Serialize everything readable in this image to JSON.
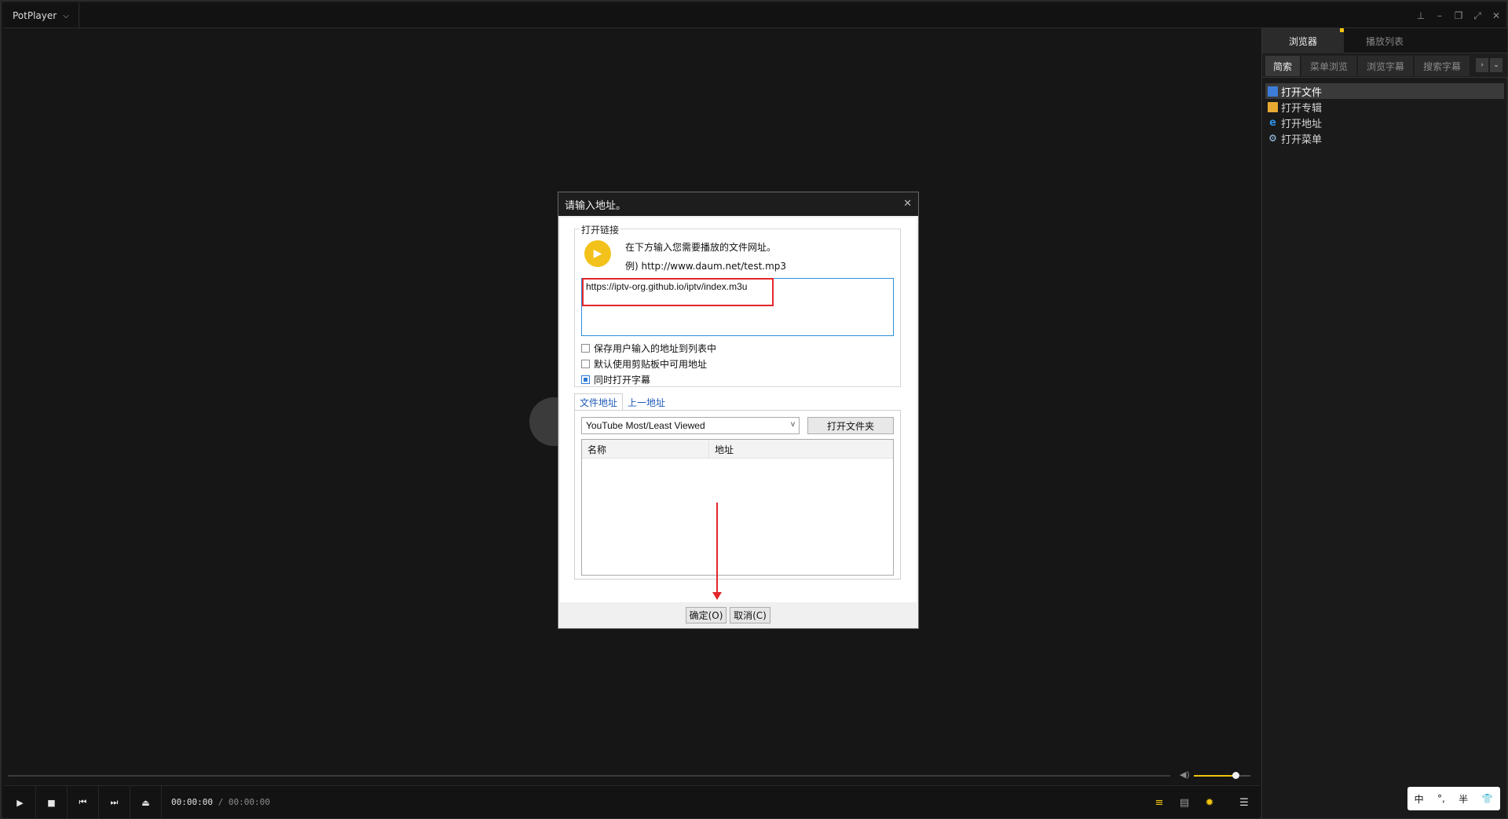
{
  "app": {
    "title": "PotPlayer",
    "window_controls": [
      "pin-icon",
      "minimize-icon",
      "restore-icon",
      "fullscreen-icon",
      "close-icon"
    ]
  },
  "player": {
    "time_current": "00:00:00",
    "time_separator": "/",
    "time_total": "00:00:00",
    "volume_fraction": 0.73,
    "accent_color": "#f1c40f",
    "controls": [
      "play-icon",
      "stop-icon",
      "previous-icon",
      "next-icon",
      "eject-icon"
    ],
    "right_controls": [
      "playlist-search-icon",
      "info-icon",
      "settings-icon",
      "menu-icon"
    ]
  },
  "sidebar": {
    "tabs": [
      {
        "label": "浏览器",
        "active": true
      },
      {
        "label": "播放列表",
        "active": false
      }
    ],
    "sub_tabs": [
      {
        "label": "简索",
        "active": true
      },
      {
        "label": "菜单浏览",
        "active": false
      },
      {
        "label": "浏览字幕",
        "active": false
      },
      {
        "label": "搜索字幕",
        "active": false
      }
    ],
    "items": [
      {
        "label": "打开文件",
        "icon": "folder-icon",
        "selected": true
      },
      {
        "label": "打开专辑",
        "icon": "album-icon",
        "selected": false
      },
      {
        "label": "打开地址",
        "icon": "ie-icon",
        "selected": false
      },
      {
        "label": "打开菜单",
        "icon": "gear-icon",
        "selected": false
      }
    ]
  },
  "ime": {
    "mode": "中",
    "punct": "°,",
    "width": "半",
    "skin_icon": "shirt-icon"
  },
  "dialog": {
    "title": "请输入地址。",
    "group_label": "打开链接",
    "hint_line1": "在下方输入您需要播放的文件网址。",
    "hint_line2": "例) http://www.daum.net/test.mp3",
    "url_value": "https://iptv-org.github.io/iptv/index.m3u",
    "checkboxes": [
      {
        "label": "保存用户输入的地址到列表中",
        "checked": false
      },
      {
        "label": "默认使用剪贴板中可用地址",
        "checked": false
      },
      {
        "label": "同时打开字幕",
        "checked": true
      }
    ],
    "tabs": [
      {
        "label": "文件地址",
        "active": true
      },
      {
        "label": "上一地址",
        "active": false
      }
    ],
    "combo_value": "YouTube Most/Least Viewed",
    "open_folder_label": "打开文件夹",
    "columns": [
      "名称",
      "地址"
    ],
    "ok_label": "确定(O)",
    "cancel_label": "取消(C)",
    "highlight_color": "#e3262b"
  }
}
